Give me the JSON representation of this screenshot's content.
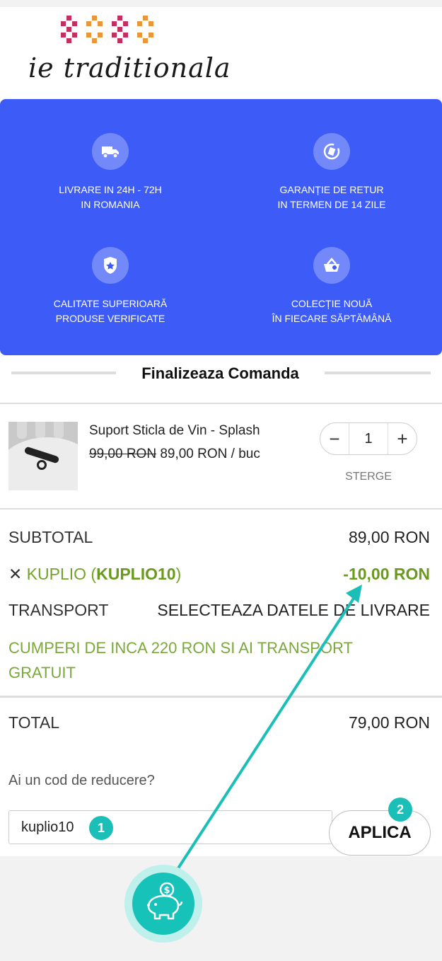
{
  "brand": {
    "logo_text": "ie traditionala",
    "colors": {
      "pink": "#c2305f",
      "orange": "#e8963a",
      "blue": "#3d5cf7",
      "green": "#74a329",
      "teal": "#1bbfb8"
    }
  },
  "features": [
    {
      "icon": "truck-icon",
      "line1": "LIVRARE IN 24H - 72H",
      "line2": "IN ROMANIA"
    },
    {
      "icon": "return-icon",
      "line1": "GARANȚIE DE RETUR",
      "line2": "IN TERMEN DE 14 ZILE"
    },
    {
      "icon": "shield-star-icon",
      "line1": "CALITATE SUPERIOARĂ",
      "line2": "PRODUSE VERIFICATE"
    },
    {
      "icon": "basket-icon",
      "line1": "COLECȚIE NOUĂ",
      "line2": "ÎN FIECARE SĂPTĂMÂNĂ"
    }
  ],
  "checkout": {
    "title": "Finalizeaza Comanda",
    "product": {
      "name": "Suport Sticla de Vin - Splash",
      "old_price": "99,00 RON",
      "price": "89,00 RON / buc",
      "quantity": "1",
      "minus": "−",
      "plus": "+",
      "remove_label": "STERGE"
    },
    "summary": {
      "subtotal_label": "SUBTOTAL",
      "subtotal_value": "89,00 RON",
      "coupon_x": "✕",
      "coupon_label": "KUPLIO (",
      "coupon_code": "KUPLIO10",
      "coupon_close": ")",
      "coupon_value": "-10,00 RON",
      "transport_label": "TRANSPORT",
      "transport_value": "SELECTEAZA DATELE DE LIVRARE",
      "free_shipping_note": "CUMPERI DE INCA 220 RON SI AI TRANSPORT GRATUIT",
      "total_label": "TOTAL",
      "total_value": "79,00 RON"
    },
    "promo": {
      "question": "Ai un cod de reducere?",
      "input_value": "kuplio10",
      "apply_label": "APLICA"
    }
  },
  "annotations": {
    "badge1": "1",
    "badge2": "2",
    "pig_icon": "piggy-bank-icon"
  }
}
